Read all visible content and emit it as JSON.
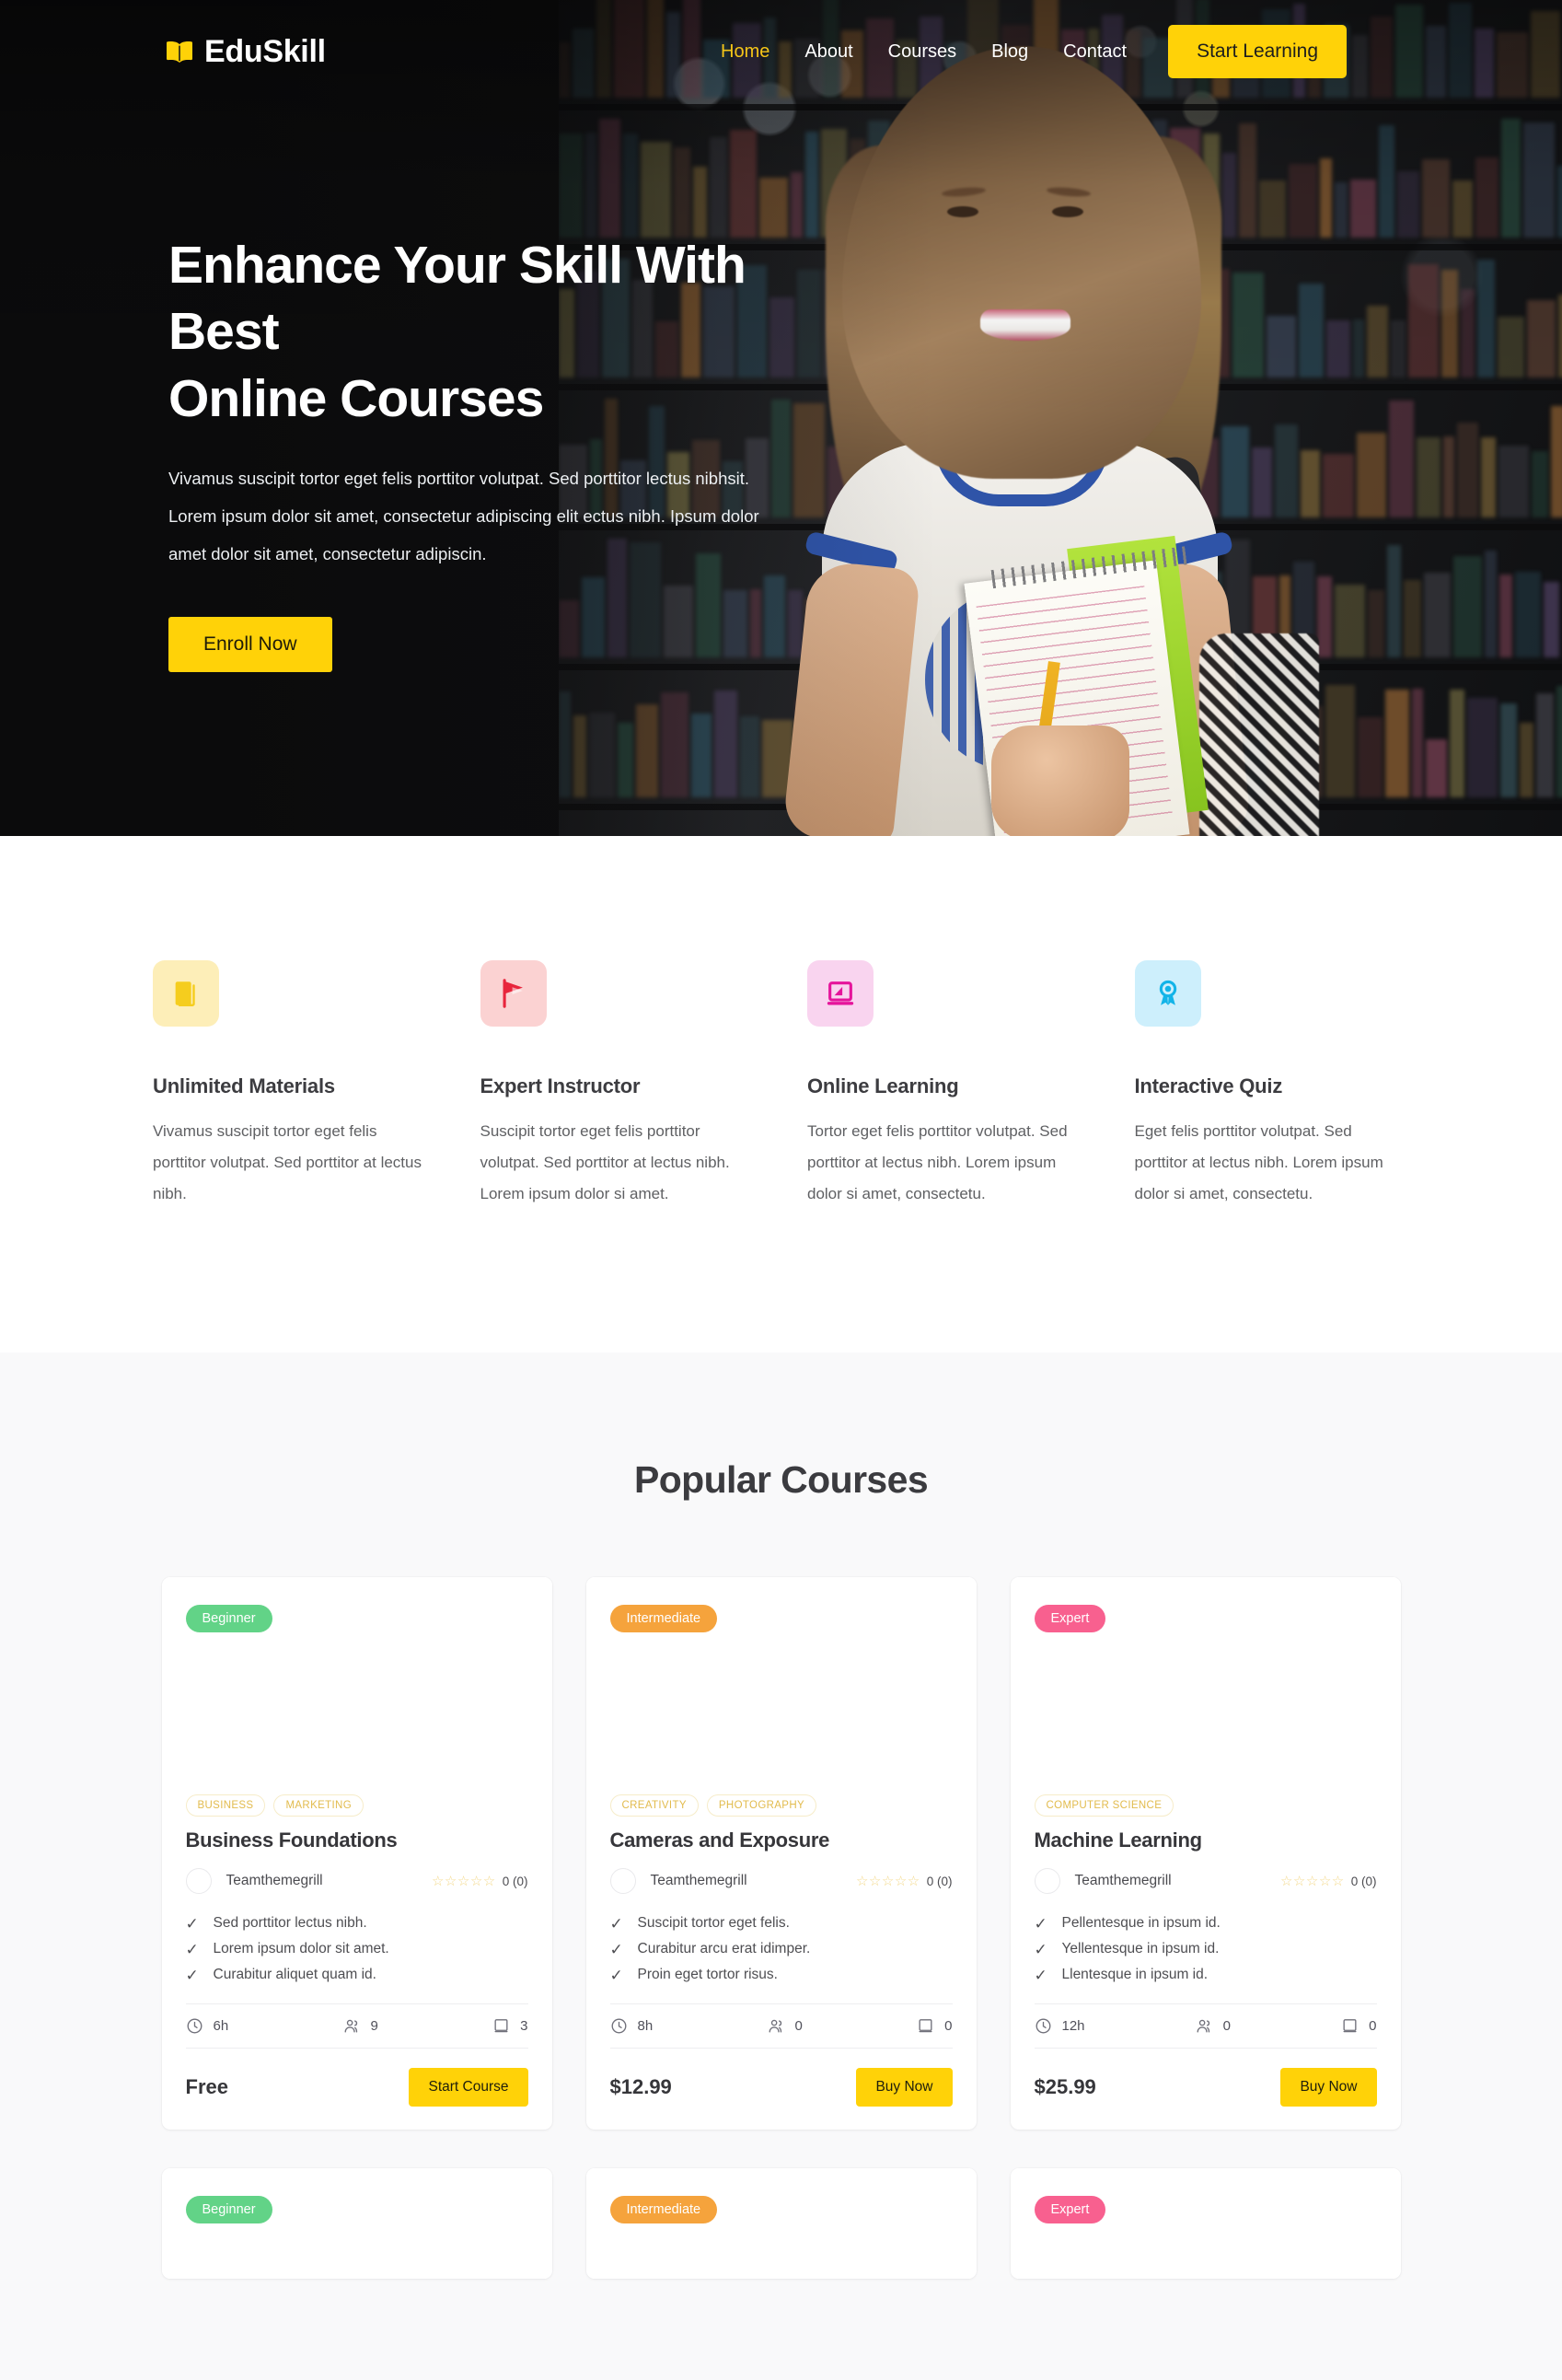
{
  "brand": {
    "name": "EduSkill",
    "logo_icon": "open-book-icon",
    "accent": "#ffd208"
  },
  "nav": {
    "items": [
      {
        "label": "Home",
        "active": true
      },
      {
        "label": "About",
        "active": false
      },
      {
        "label": "Courses",
        "active": false
      },
      {
        "label": "Blog",
        "active": false
      },
      {
        "label": "Contact",
        "active": false
      }
    ],
    "cta_label": "Start Learning"
  },
  "hero": {
    "title_line1": "Enhance Your Skill With Best",
    "title_line2": "Online Courses",
    "paragraph": "Vivamus suscipit tortor eget felis porttitor volutpat. Sed porttitor lectus nibhsit. Lorem ipsum dolor sit amet, consectetur adipiscing elit ectus nibh. Ipsum dolor amet dolor sit amet, consectetur adipiscin.",
    "cta_label": "Enroll Now"
  },
  "features": [
    {
      "icon": "book-icon",
      "icon_bg": "#fdeeb8",
      "icon_color": "#f5cd1e",
      "title": "Unlimited Materials",
      "text": "Vivamus suscipit tortor eget felis porttitor volutpat. Sed porttitor at lectus nibh."
    },
    {
      "icon": "graduation-cap-flag-icon",
      "icon_bg": "#fbd2d2",
      "icon_color": "#e8253c",
      "title": "Expert Instructor",
      "text": "Suscipit tortor eget felis porttitor volutpat. Sed porttitor at lectus nibh. Lorem ipsum dolor si amet."
    },
    {
      "icon": "laptop-icon",
      "icon_bg": "#f9d4ef",
      "icon_color": "#e5149b",
      "title": "Online Learning",
      "text": "Tortor eget felis porttitor volutpat. Sed porttitor at lectus nibh. Lorem ipsum dolor si amet, consectetu."
    },
    {
      "icon": "award-ribbon-icon",
      "icon_bg": "#cdeffc",
      "icon_color": "#13b4e8",
      "title": "Interactive Quiz",
      "text": "Eget felis porttitor volutpat. Sed porttitor at lectus nibh. Lorem ipsum dolor si amet, consectetu."
    }
  ],
  "courses_section": {
    "title": "Popular Courses",
    "cards": [
      {
        "level": "Beginner",
        "level_class": "beginner",
        "tags": [
          "BUSINESS",
          "MARKETING"
        ],
        "title": "Business Foundations",
        "author": "Teamthemegrill",
        "stars": "☆☆☆☆☆",
        "rating": "0 (0)",
        "features": [
          "Sed porttitor lectus nibh.",
          "Lorem ipsum dolor sit amet.",
          "Curabitur aliquet quam id."
        ],
        "duration": "6h",
        "students": "9",
        "lessons": "3",
        "price": "Free",
        "cta": "Start Course"
      },
      {
        "level": "Intermediate",
        "level_class": "intermediate",
        "tags": [
          "CREATIVITY",
          "PHOTOGRAPHY"
        ],
        "title": "Cameras and Exposure",
        "author": "Teamthemegrill",
        "stars": "☆☆☆☆☆",
        "rating": "0 (0)",
        "features": [
          "Suscipit tortor eget felis.",
          "Curabitur arcu erat idimper.",
          "Proin eget tortor risus."
        ],
        "duration": "8h",
        "students": "0",
        "lessons": "0",
        "price": "$12.99",
        "cta": "Buy Now"
      },
      {
        "level": "Expert",
        "level_class": "expert",
        "tags": [
          "COMPUTER SCIENCE"
        ],
        "title": "Machine Learning",
        "author": "Teamthemegrill",
        "stars": "☆☆☆☆☆",
        "rating": "0 (0)",
        "features": [
          "Pellentesque in ipsum id.",
          "Yellentesque in ipsum id.",
          "Llentesque in ipsum id."
        ],
        "duration": "12h",
        "students": "0",
        "lessons": "0",
        "price": "$25.99",
        "cta": "Buy Now"
      }
    ],
    "next_row_levels": [
      {
        "level": "Beginner",
        "level_class": "beginner"
      },
      {
        "level": "Intermediate",
        "level_class": "intermediate"
      },
      {
        "level": "Expert",
        "level_class": "expert"
      }
    ]
  },
  "icons": {
    "clock": "clock-icon",
    "users": "users-icon",
    "book": "book-icon",
    "check": "✓"
  }
}
